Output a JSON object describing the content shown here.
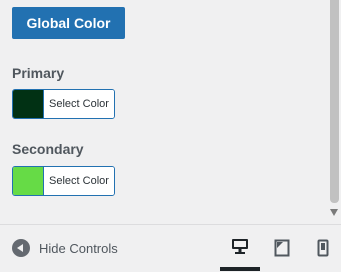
{
  "global_color_button": "Global Color",
  "primary": {
    "label": "Primary",
    "picker_label": "Select Color",
    "color": "#013114"
  },
  "secondary": {
    "label": "Secondary",
    "picker_label": "Select Color",
    "color": "#66db46"
  },
  "footer": {
    "hide_controls_label": "Hide Controls",
    "devices": [
      "desktop-icon",
      "tablet-icon",
      "mobile-icon"
    ],
    "active_device": "desktop"
  },
  "accent_color": "#2271b1"
}
